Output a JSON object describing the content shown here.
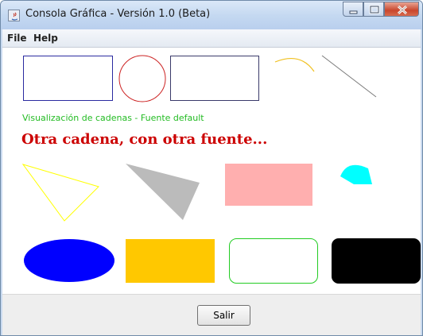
{
  "window": {
    "title": "Consola Gráfica - Versión 1.0 (Beta)",
    "icon": "java-app-icon",
    "controls": [
      "minimize-icon",
      "maximize-icon",
      "close-icon"
    ]
  },
  "menubar": {
    "items": [
      "File",
      "Help"
    ]
  },
  "canvas": {
    "string_default": "Visualización de cadenas - Fuente default",
    "string_custom": "Otra cadena, con otra fuente...",
    "colors": {
      "row1_rect1": "#2a2aa0",
      "row1_circle": "#cc2222",
      "row1_rect2": "#3a3a6a",
      "row1_arc": "#f0c020",
      "row1_line": "#7a7a7a",
      "triangle_outline": "#ffff00",
      "triangle_fill": "#bbbbbb",
      "pink_rect": "#ffafaf",
      "cyan_arc": "#00ffff",
      "blue_oval": "#0000ff",
      "orange_rect": "#ffc800",
      "green_round_rect": "#22cc22",
      "black_round_rect": "#000000",
      "string_default": "#22bb22",
      "string_custom": "#cc0000"
    }
  },
  "footer": {
    "exit_label": "Salir"
  }
}
